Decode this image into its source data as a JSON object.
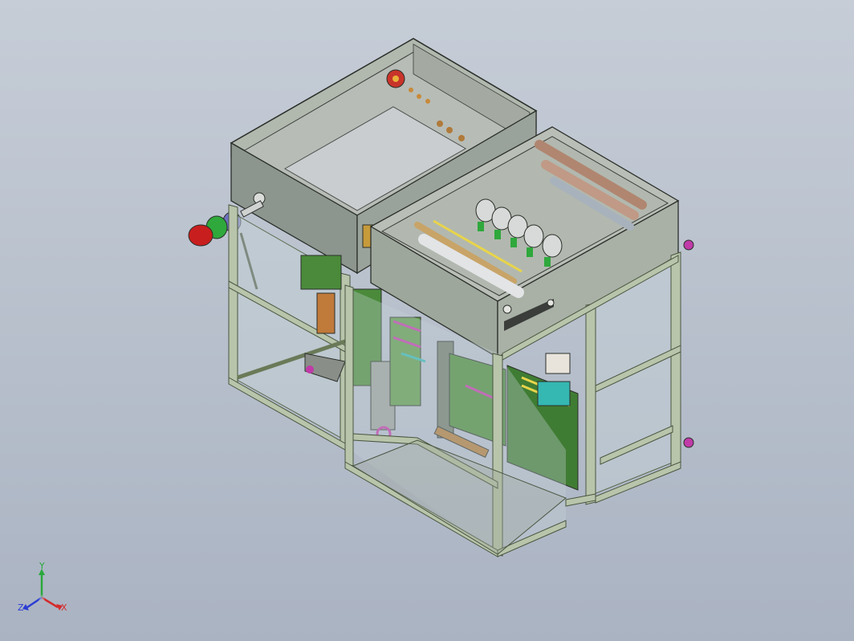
{
  "viewport": {
    "background_top": "#c6cdd7",
    "background_bottom": "#aab3c2"
  },
  "model": {
    "frame_color": "#b8c5ab",
    "panel_color": "#a8afa5",
    "enclosure_color": "#a6ada4",
    "glass_color": "#c6d4d9",
    "board_color": "#4a8a3a",
    "accents": {
      "red": "#c81e1e",
      "green": "#2fa83c",
      "magenta": "#c03aa8",
      "cyan": "#35b7b2",
      "copper": "#b07a3a"
    }
  },
  "triad": {
    "x_label": "X",
    "y_label": "Y",
    "z_label": "Z",
    "x_color": "#d42a2a",
    "y_color": "#2aa83c",
    "z_color": "#2a3cd4"
  }
}
